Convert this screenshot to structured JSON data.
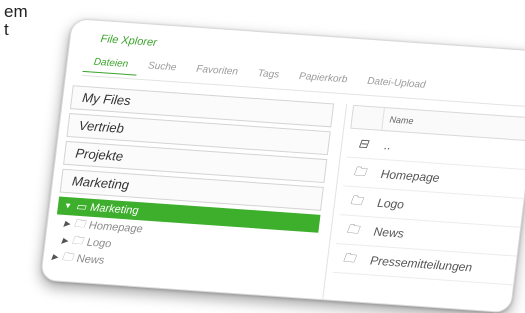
{
  "background": {
    "line1": "em",
    "line2": "t"
  },
  "app": {
    "title": "File Xplorer"
  },
  "tabs": [
    {
      "label": "Dateien",
      "active": true
    },
    {
      "label": "Suche"
    },
    {
      "label": "Favoriten"
    },
    {
      "label": "Tags"
    },
    {
      "label": "Papierkorb"
    },
    {
      "label": "Datei-Upload"
    }
  ],
  "quick_folders": [
    "My Files",
    "Vertrieb",
    "Projekte",
    "Marketing"
  ],
  "tree": {
    "active": {
      "label": "Marketing",
      "icon": "folder-open-icon"
    },
    "items": [
      {
        "label": "Homepage",
        "icon": "folder-icon",
        "level": 1
      },
      {
        "label": "Logo",
        "icon": "folder-icon",
        "level": 1
      },
      {
        "label": "News",
        "icon": "folder-icon",
        "level": 0
      }
    ]
  },
  "file_list": {
    "column_name": "Name",
    "rows": [
      {
        "name": "..",
        "icon": "folder-up-icon"
      },
      {
        "name": "Homepage",
        "icon": "folder-icon"
      },
      {
        "name": "Logo",
        "icon": "folder-icon"
      },
      {
        "name": "News",
        "icon": "folder-icon"
      },
      {
        "name": "Pressemitteilungen",
        "icon": "folder-icon"
      }
    ]
  },
  "colors": {
    "accent": "#3daf2c",
    "title": "#3aa32a"
  }
}
